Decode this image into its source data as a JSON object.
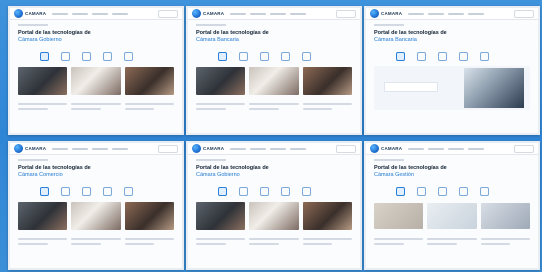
{
  "screens": [
    {
      "brand": "CAMARA",
      "title_line1": "Portal de las tecnologías de",
      "title_line2": "Cámara Gobierno",
      "layout": "tiles"
    },
    {
      "brand": "CAMARA",
      "title_line1": "Portal de las tecnologías de",
      "title_line2": "Cámara Bancaria",
      "layout": "tiles"
    },
    {
      "brand": "CAMARA",
      "title_line1": "Portal de las tecnologías de",
      "title_line2": "Cámara Bancaria",
      "layout": "feature"
    },
    {
      "brand": "CAMARA",
      "title_line1": "Portal de las tecnologías de",
      "title_line2": "Cámara Comercio",
      "layout": "tiles"
    },
    {
      "brand": "CAMARA",
      "title_line1": "Portal de las tecnologías de",
      "title_line2": "Cámara Gobierno",
      "layout": "tiles"
    },
    {
      "brand": "CAMARA",
      "title_line1": "Portal de las tecnologías de",
      "title_line2": "Cámara Gestión",
      "layout": "thumbs"
    }
  ]
}
